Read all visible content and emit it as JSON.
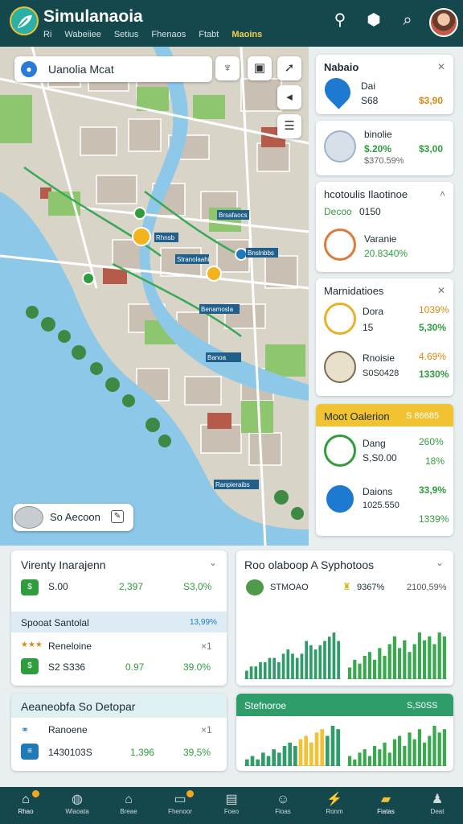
{
  "app": {
    "title": "Simulanaoia"
  },
  "nav": [
    "Ri",
    "Wabeiiee",
    "Setius",
    "Fhenaos",
    "Ftabt",
    "Maoins"
  ],
  "map": {
    "search_text": "Uanolia Mcat",
    "chip_label": "So Aecoon",
    "labels": [
      "Rhnsb",
      "Brsafaocs",
      "Stranolaahi",
      "Bnslnbbs",
      "Benamosla",
      "Banoa",
      "Ranpieraibs"
    ]
  },
  "cards": {
    "c1": {
      "title": "Nabaio",
      "name": "Dai",
      "sub": "S68",
      "value": "$3,90"
    },
    "c2": {
      "name": "binolie",
      "pct": "$.20%",
      "value": "$3,00",
      "sub": "$370.59%"
    },
    "c3": {
      "title": "hcotoulis Ilaotinoe",
      "sub1": "Decoo",
      "sub2": "0150",
      "name": "Varanie",
      "value": "20.8340%"
    },
    "c4": {
      "title": "Marnidatioes",
      "r1_name": "Dora",
      "r1_pct": "1039%",
      "r1_sub": "15",
      "r1_val": "5,30%",
      "r2_name": "Rnoisie",
      "r2_pct": "4.69%",
      "r2_sub": "S0S0428",
      "r2_val": "1330%"
    },
    "c5": {
      "title": "Moot Oalerion",
      "title_val": "S 86685",
      "r1_name": "Dang",
      "r1_pct": "260%",
      "r1_sub": "S,S0.00",
      "r1_val": "18%",
      "r2_name": "Daions",
      "r2_pct": "33,9%",
      "r2_sub": "1025.550",
      "r2_val": "1339%"
    }
  },
  "b1": {
    "title": "Virenty Inarajenn",
    "r1": [
      "S.00",
      "2,397",
      "S3,0%"
    ],
    "sec": "Spooat Santolal",
    "sec_val": "13,99%",
    "r2_name": "Reneloine",
    "r2_x": "×1",
    "r3": [
      "S2 S336",
      "0.97",
      "39.0%"
    ]
  },
  "b2": {
    "title": "Roo olaboop A Syphotoos",
    "r1": [
      "STMOAO",
      "9367%",
      "2100,59%"
    ]
  },
  "b3": {
    "title": "Aeaneobfa So Detopar",
    "r1_name": "Ranoene",
    "r1_x": "×1",
    "r2": [
      "1430103S",
      "1,396",
      "39,5%"
    ]
  },
  "b4": {
    "title": "Stefnoroe",
    "title_val": "S,S0SS"
  },
  "chart_data": [
    {
      "type": "bar",
      "title": "",
      "series": [
        {
          "name": "",
          "values": [
            2,
            3,
            3,
            4,
            4,
            5,
            5,
            4,
            6,
            7,
            6,
            5,
            6,
            9,
            8,
            7,
            8,
            9,
            10,
            11,
            9
          ]
        }
      ]
    },
    {
      "type": "bar",
      "title": "",
      "series": [
        {
          "name": "",
          "values": [
            3,
            5,
            4,
            6,
            7,
            5,
            8,
            6,
            9,
            11,
            8,
            10,
            7,
            9,
            12,
            10,
            11,
            9,
            12,
            11
          ]
        }
      ]
    },
    {
      "type": "bar",
      "title": "",
      "series": [
        {
          "name": "",
          "values": [
            2,
            3,
            2,
            4,
            3,
            5,
            4,
            6,
            7,
            6,
            8,
            9,
            7,
            10,
            11,
            9,
            12,
            11
          ]
        }
      ]
    },
    {
      "type": "bar",
      "title": "",
      "series": [
        {
          "name": "",
          "values": [
            3,
            2,
            4,
            5,
            3,
            6,
            5,
            7,
            4,
            8,
            9,
            6,
            10,
            8,
            11,
            7,
            9,
            12,
            10,
            11
          ]
        }
      ]
    }
  ],
  "bottom_nav": [
    "Rhao",
    "Wlaoata",
    "Breae",
    "Fhenoor",
    "Foeo",
    "Fioas",
    "Ronm",
    "Fiatas",
    "Deat"
  ]
}
